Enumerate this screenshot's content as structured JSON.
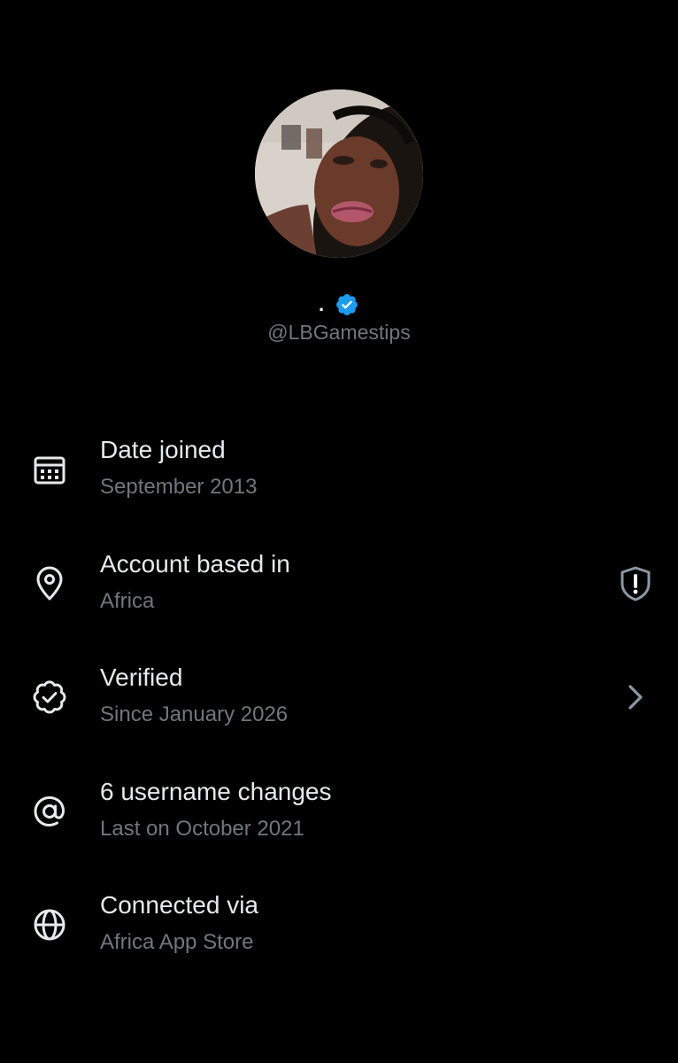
{
  "profile": {
    "display_name": ".",
    "handle": "@LBGamestips",
    "verified": true,
    "badge_color": "#1d9bf0"
  },
  "info_rows": [
    {
      "icon": "calendar-icon",
      "title": "Date joined",
      "subtitle": "September 2013"
    },
    {
      "icon": "location-pin-icon",
      "title": "Account based in",
      "subtitle": "Africa",
      "trailing_icon": "shield-alert-icon"
    },
    {
      "icon": "verified-check-icon",
      "title": "Verified",
      "subtitle": "Since January 2026",
      "trailing_icon": "chevron-right-icon"
    },
    {
      "icon": "at-sign-icon",
      "title": "6 username changes",
      "subtitle": "Last on October 2021"
    },
    {
      "icon": "globe-icon",
      "title": "Connected via",
      "subtitle": "Africa App Store"
    }
  ],
  "colors": {
    "background": "#000000",
    "primary_text": "#e7e9ea",
    "secondary_text": "#71767b",
    "accent": "#1d9bf0"
  }
}
